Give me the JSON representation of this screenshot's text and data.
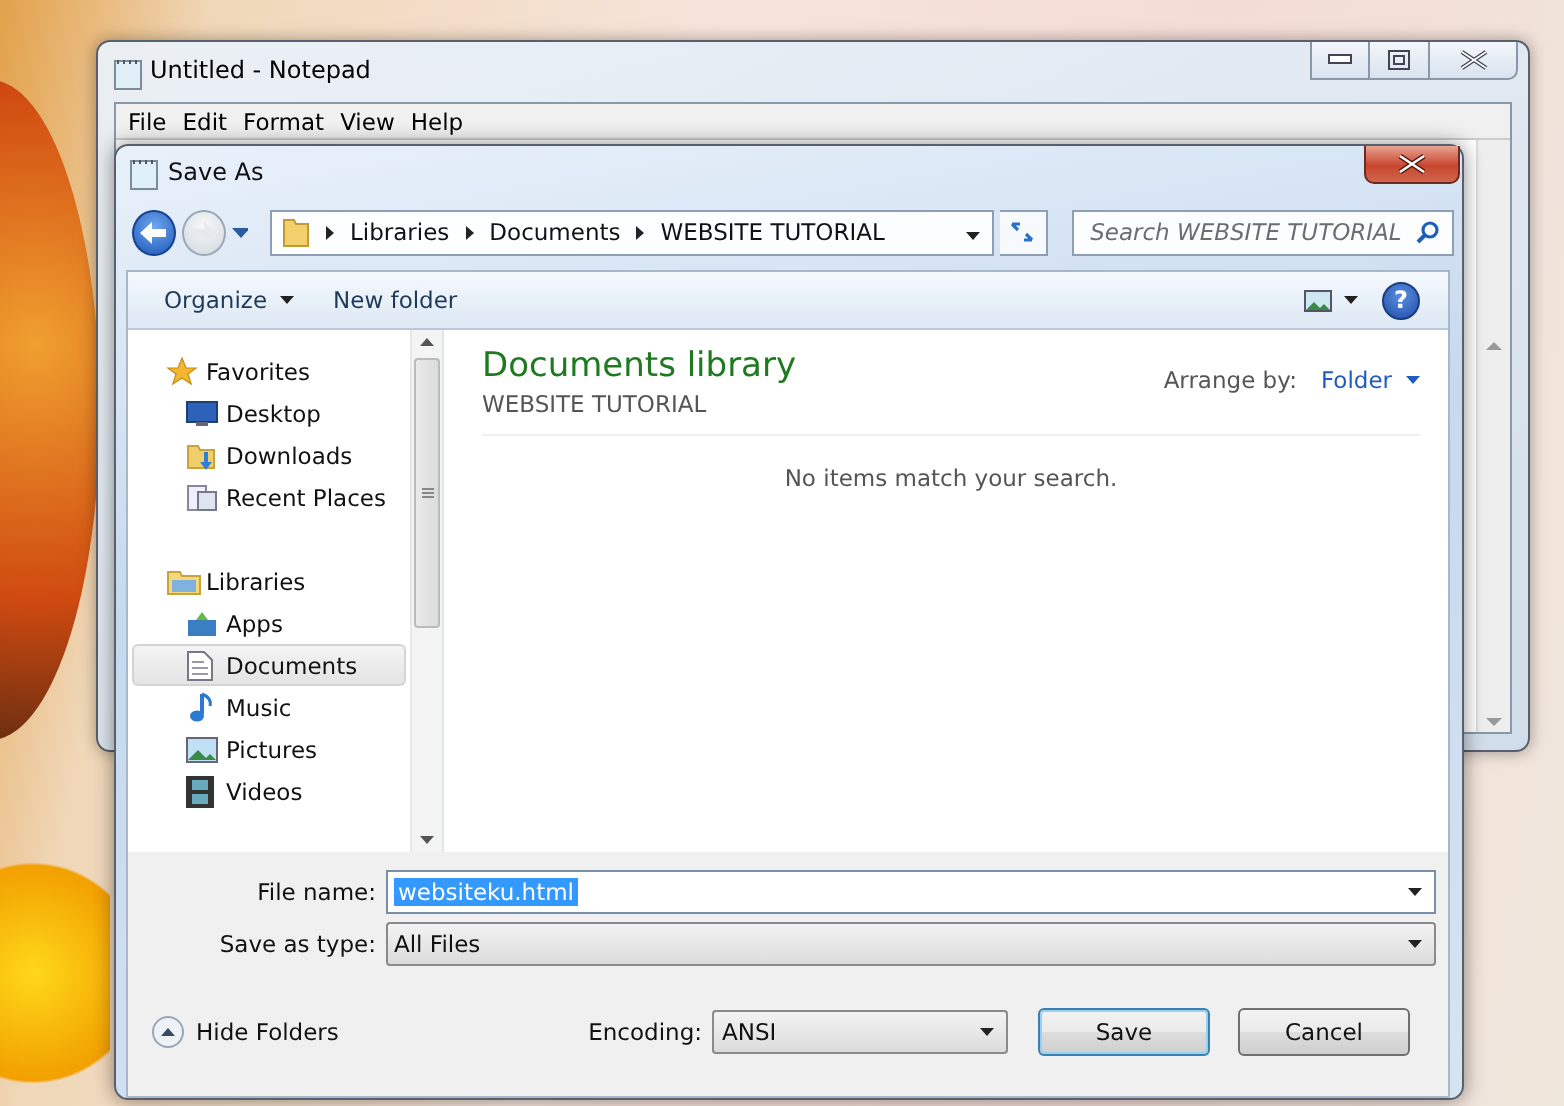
{
  "notepad": {
    "title": "Untitled - Notepad",
    "menu": [
      "File",
      "Edit",
      "Format",
      "View",
      "Help"
    ]
  },
  "dialog": {
    "title": "Save As",
    "breadcrumb": [
      "Libraries",
      "Documents",
      "WEBSITE TUTORIAL"
    ],
    "search": {
      "placeholder": "Search WEBSITE TUTORIAL"
    },
    "toolbar": [
      "Organize",
      "New folder"
    ],
    "help": "?",
    "sidebar": [
      {
        "label": "Favorites",
        "kind": "star",
        "selected": false,
        "children": [
          {
            "label": "Desktop",
            "kind": "desktop",
            "selected": false
          },
          {
            "label": "Downloads",
            "kind": "downloads",
            "selected": false
          },
          {
            "label": "Recent Places",
            "kind": "recent",
            "selected": false
          }
        ]
      },
      {
        "label": "Libraries",
        "kind": "library",
        "selected": false,
        "children": [
          {
            "label": "Apps",
            "kind": "apps",
            "selected": false
          },
          {
            "label": "Documents",
            "kind": "document",
            "selected": true
          },
          {
            "label": "Music",
            "kind": "music",
            "selected": false
          },
          {
            "label": "Pictures",
            "kind": "pictures",
            "selected": false
          },
          {
            "label": "Videos",
            "kind": "videos",
            "selected": false
          }
        ]
      }
    ],
    "content": {
      "title": "Documents library",
      "subtitle": "WEBSITE TUTORIAL",
      "arrange_label": "Arrange by:",
      "arrange_value": "Folder",
      "empty_message": "No items match your search."
    },
    "file_name": {
      "label": "File name:",
      "value": "websiteku.html"
    },
    "save_as_type": {
      "label": "Save as type:",
      "value": "All Files"
    },
    "hide_folders": "Hide Folders",
    "encoding": {
      "label": "Encoding:",
      "value": "ANSI"
    },
    "buttons": [
      {
        "label": "Save",
        "default": true
      },
      {
        "label": "Cancel",
        "default": false
      }
    ]
  }
}
